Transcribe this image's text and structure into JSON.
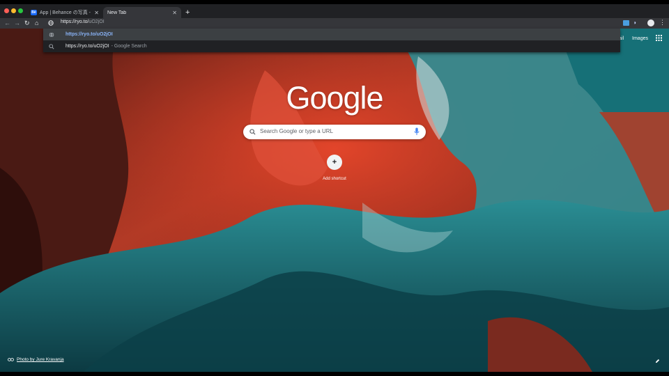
{
  "colors": {
    "chrome_dark": "#202124",
    "toolbar": "#35363a",
    "url_blue": "#8ab4f8",
    "accent_blue": "#4285f4"
  },
  "tabs": [
    {
      "title": "App | Behance の写真 - ビデオ",
      "favicon": "Bē",
      "active": false
    },
    {
      "title": "New Tab",
      "active": true
    }
  ],
  "toolbar": {
    "omnibox_bold": "https://ryo.to/",
    "omnibox_rest": "uO2jOI"
  },
  "dropdown": {
    "items": [
      {
        "text": "https://ryo.to/uO2jOI",
        "icon": "globe-icon"
      },
      {
        "text": "https://ryo.to/uO2jOI",
        "hint": "- Google Search",
        "icon": "search-icon"
      }
    ]
  },
  "ntp": {
    "links": [
      "Gmail",
      "Images"
    ],
    "logo": "Google",
    "search_placeholder": "Search Google or type a URL",
    "add_shortcut_label": "Add shortcut",
    "add_shortcut_symbol": "+",
    "photo_credit": "Photo by Jure Kravanja"
  },
  "icons": {
    "back": "back-arrow-icon",
    "forward": "forward-arrow-icon",
    "reload": "reload-icon",
    "home": "home-icon",
    "tab_close": "close-icon",
    "new_tab": "plus-icon",
    "menu": "kebab-menu-icon",
    "apps": "apps-grid-icon",
    "mic": "microphone-icon",
    "customize": "pencil-icon"
  }
}
